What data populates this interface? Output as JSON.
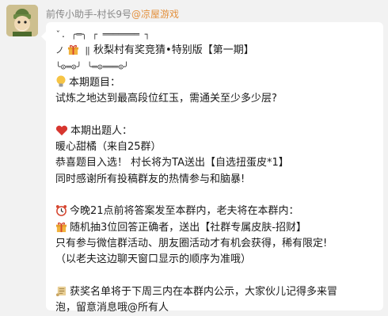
{
  "sender": {
    "name": "前传小助手-村长9号",
    "group": "@凉屋游戏"
  },
  "message": {
    "deco_top": "ˇ. ╭═╮ ┌ ═══════ ┐",
    "title_line": "秋梨村有奖竞猜•特别版【第一期】",
    "deco_bottom": "╰⊙═⊙╯ ╰═⊙═══⊙╯",
    "question_heading": "本期题目：",
    "question_text": "试炼之地达到最高段位红玉，需通关至少多少层?",
    "author_heading": "本期出题人：",
    "author_name": "暖心甜橘（来自25群）",
    "author_reward": "恭喜题目入选！ 村长将为TA送出【自选扭蛋皮*1】",
    "author_thanks": "同时感谢所有投稿群友的热情参与和脑暴!",
    "time_line": "今晚21点前将答案发至本群内，老夫将在本群内：",
    "prize_line": "随机抽3位回答正确者，送出【社群专属皮肤-招财】",
    "condition_line": "只有参与微信群活动、朋友圈活动才有机会获得，稀有限定!",
    "order_note": "（以老夫这边聊天窗口显示的顺序为准哦）",
    "announce_line1": "获奖名单将于下周三内在本群内公示，大家伙儿记得多来冒",
    "announce_line2": "泡，留意消息哦@所有人"
  }
}
